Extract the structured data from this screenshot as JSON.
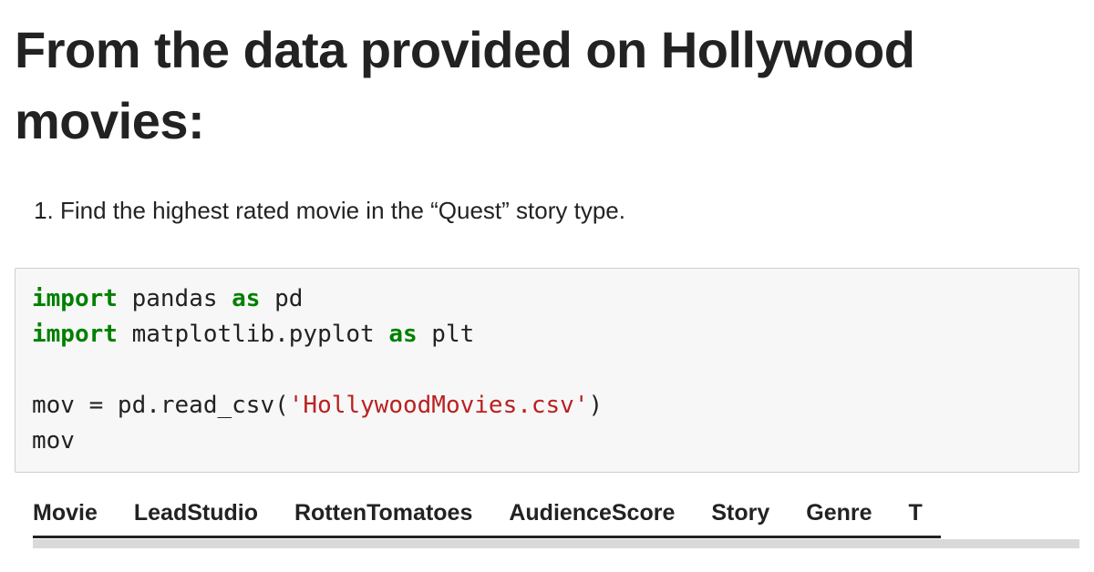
{
  "heading": "From the data provided on Hollywood movies:",
  "list": {
    "items": [
      "Find the highest rated movie in the “Quest” story type."
    ]
  },
  "code": {
    "tokens": [
      {
        "t": "import",
        "c": "kw"
      },
      {
        "t": " pandas ",
        "c": ""
      },
      {
        "t": "as",
        "c": "kw"
      },
      {
        "t": " pd\n",
        "c": ""
      },
      {
        "t": "import",
        "c": "kw"
      },
      {
        "t": " matplotlib.pyplot ",
        "c": ""
      },
      {
        "t": "as",
        "c": "kw"
      },
      {
        "t": " plt\n\nmov = pd.read_csv(",
        "c": ""
      },
      {
        "t": "'HollywoodMovies.csv'",
        "c": "str"
      },
      {
        "t": ")\nmov",
        "c": ""
      }
    ]
  },
  "table": {
    "headers": [
      "Movie",
      "LeadStudio",
      "RottenTomatoes",
      "AudienceScore",
      "Story",
      "Genre",
      "T"
    ]
  }
}
